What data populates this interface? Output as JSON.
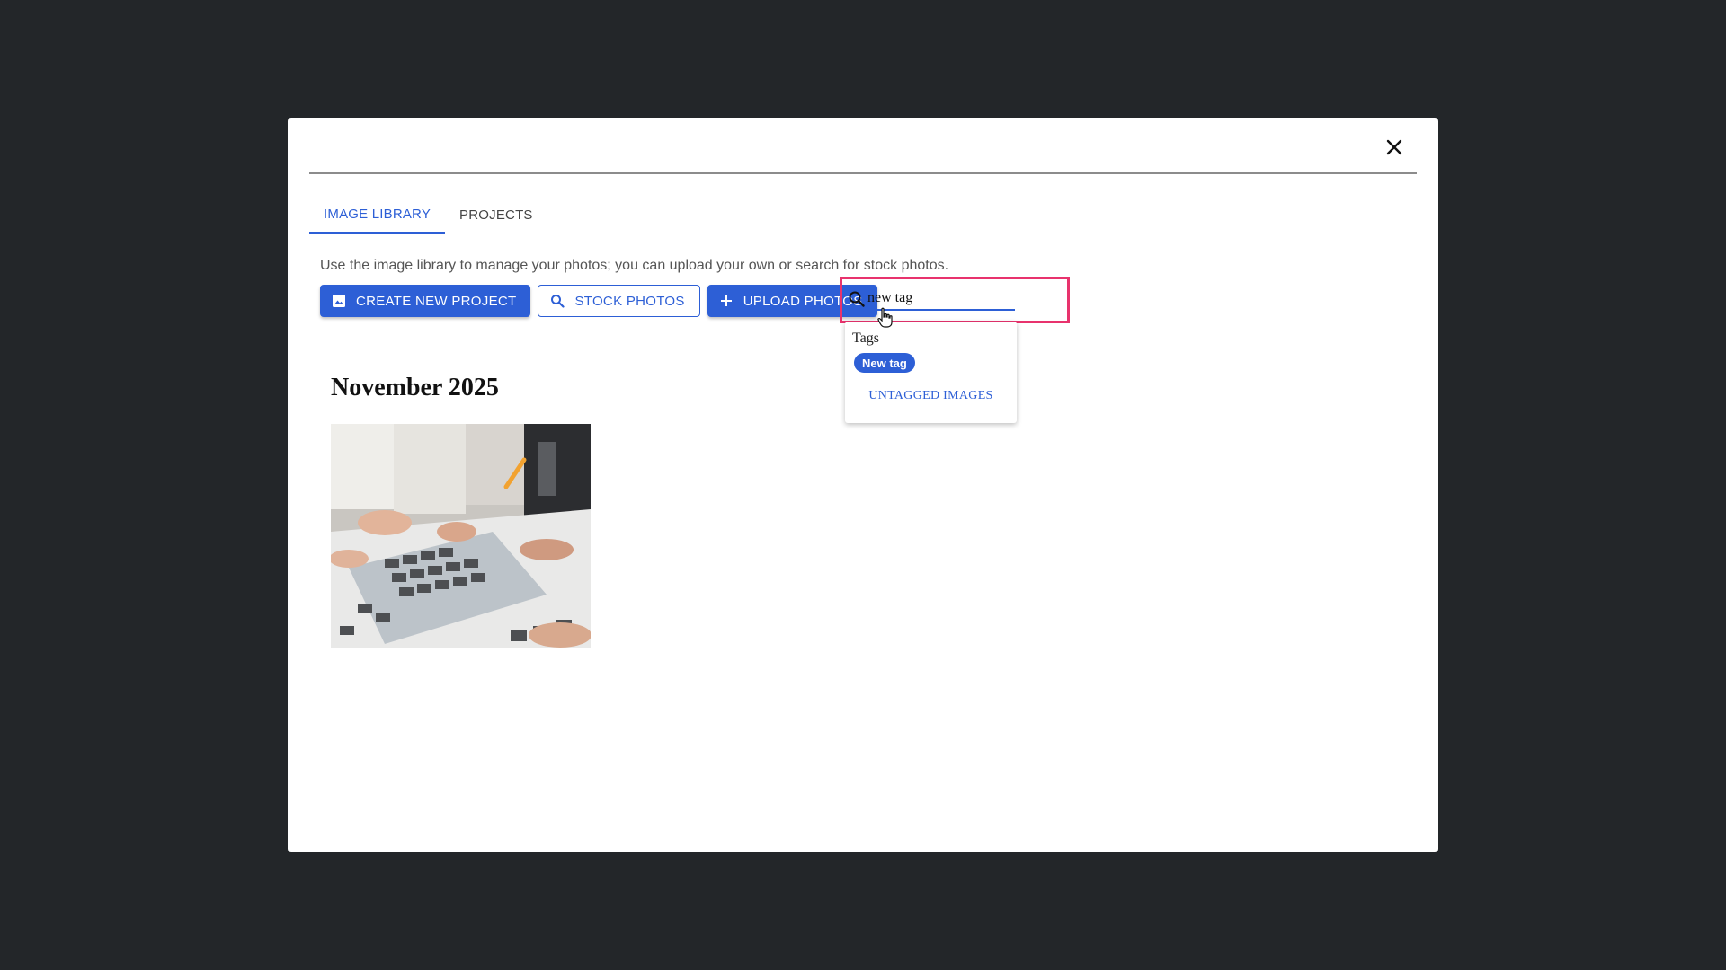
{
  "dialog": {
    "close_icon": "close-icon",
    "tabs": [
      {
        "label": "IMAGE LIBRARY",
        "active": true
      },
      {
        "label": "PROJECTS",
        "active": false
      }
    ],
    "intro_text": "Use the image library to manage your photos; you can upload your own or search for stock photos.",
    "toolbar": {
      "create_project_label": "CREATE NEW PROJECT",
      "create_project_icon": "image-icon",
      "stock_photos_label": "STOCK PHOTOS",
      "stock_photos_icon": "search-icon",
      "upload_photos_label": "UPLOAD PHOTOS",
      "upload_photos_icon": "plus-icon"
    },
    "search": {
      "value": "new tag",
      "icon": "search-icon"
    },
    "dropdown": {
      "title": "Tags",
      "tags": [
        "New tag"
      ],
      "untagged_label": "UNTAGGED IMAGES"
    },
    "gallery": {
      "section_title": "November 2025",
      "photos": [
        {
          "description_icon": "photo-thumbnail"
        }
      ]
    }
  },
  "colors": {
    "backdrop": "#232629",
    "accent": "#2d5fd6",
    "highlight": "#e8336d"
  }
}
